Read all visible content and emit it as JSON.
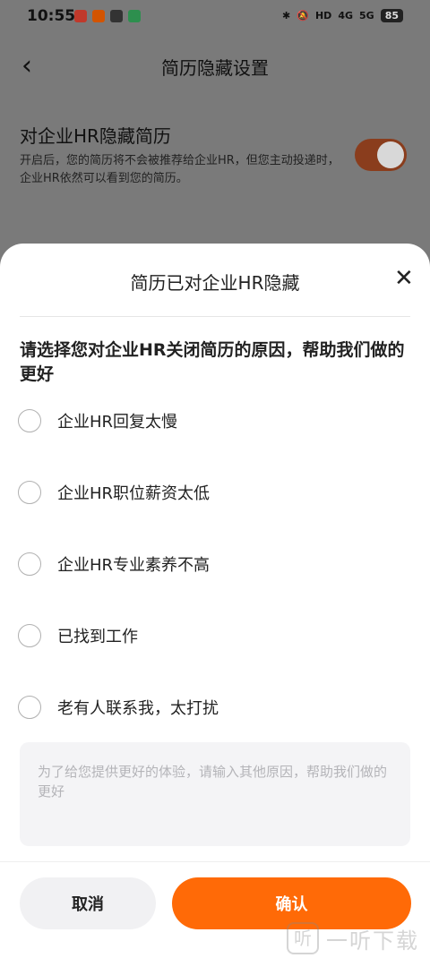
{
  "status_bar": {
    "time": "10:55",
    "network_1": "4G",
    "network_2": "5G",
    "battery": "85",
    "hd_label": "HD"
  },
  "background_page": {
    "back_icon": "chevron-left-icon",
    "title": "简历隐藏设置",
    "setting_title": "对企业HR隐藏简历",
    "setting_desc": "开启后，您的简历将不会被推荐给企业HR，但您主动投递时，企业HR依然可以看到您的简历。",
    "toggle_on": true,
    "toggle_color": "#ff6a07"
  },
  "sheet": {
    "title": "简历已对企业HR隐藏",
    "close_icon": "close-icon",
    "question": "请选择您对企业HR关闭简历的原因，帮助我们做的更好",
    "options": [
      {
        "label": "企业HR回复太慢",
        "selected": false
      },
      {
        "label": "企业HR职位薪资太低",
        "selected": false
      },
      {
        "label": "企业HR专业素养不高",
        "selected": false
      },
      {
        "label": "已找到工作",
        "selected": false
      },
      {
        "label": "老有人联系我，太打扰",
        "selected": false
      }
    ],
    "other_reason_placeholder": "为了给您提供更好的体验，请输入其他原因，帮助我们做的更好",
    "other_reason_value": "",
    "cancel_label": "取消",
    "confirm_label": "确认",
    "accent_color": "#ff6a07"
  },
  "watermark": {
    "logo": "听",
    "text": "一听下载"
  }
}
